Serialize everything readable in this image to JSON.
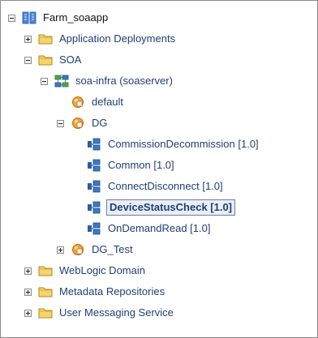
{
  "tree": {
    "nodes": [
      {
        "label": "Farm_soaapp",
        "toggle": "minus",
        "icon": "farm-icon",
        "selected": false
      },
      {
        "label": "Application Deployments",
        "toggle": "plus",
        "icon": "folder-icon",
        "selected": false
      },
      {
        "label": "SOA",
        "toggle": "minus",
        "icon": "folder-icon",
        "selected": false
      },
      {
        "label": "soa-infra (soaserver)",
        "toggle": "minus",
        "icon": "soa-infra-icon",
        "selected": false
      },
      {
        "label": "default",
        "toggle": "none",
        "icon": "partition-icon",
        "selected": false
      },
      {
        "label": "DG",
        "toggle": "minus",
        "icon": "partition-icon",
        "selected": false
      },
      {
        "label": "CommissionDecommission [1.0]",
        "toggle": "none",
        "icon": "composite-icon",
        "selected": false
      },
      {
        "label": "Common [1.0]",
        "toggle": "none",
        "icon": "composite-icon",
        "selected": false
      },
      {
        "label": "ConnectDisconnect [1.0]",
        "toggle": "none",
        "icon": "composite-icon",
        "selected": false
      },
      {
        "label": "DeviceStatusCheck [1.0]",
        "toggle": "none",
        "icon": "composite-icon",
        "selected": true
      },
      {
        "label": "OnDemandRead [1.0]",
        "toggle": "none",
        "icon": "composite-icon",
        "selected": false
      },
      {
        "label": "DG_Test",
        "toggle": "plus",
        "icon": "partition-icon",
        "selected": false
      },
      {
        "label": "WebLogic Domain",
        "toggle": "plus",
        "icon": "folder-icon",
        "selected": false
      },
      {
        "label": "Metadata Repositories",
        "toggle": "plus",
        "icon": "folder-icon",
        "selected": false
      },
      {
        "label": "User Messaging Service",
        "toggle": "plus",
        "icon": "folder-icon",
        "selected": false
      }
    ]
  },
  "colors": {
    "link_text": "#1f3f73",
    "selection_bg": "#e9eef8",
    "selection_border": "#6b7fa6",
    "folder": "#f2c94c",
    "partition": "#f29b2f",
    "composite": "#2f6fb3",
    "farm": "#3c7ad6"
  }
}
